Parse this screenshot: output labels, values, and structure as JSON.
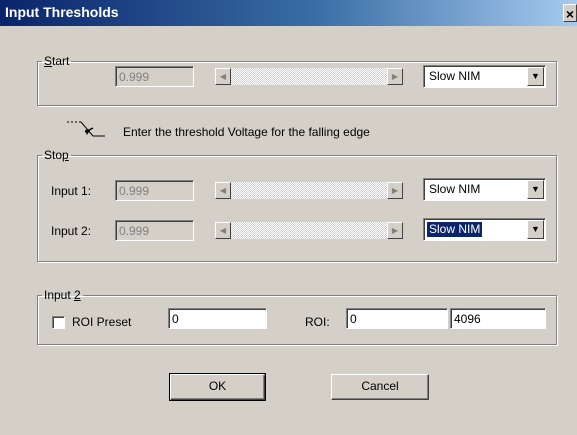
{
  "window": {
    "title": "Input Thresholds",
    "close_glyph": "×"
  },
  "start": {
    "legend_key": "S",
    "legend_rest": "tart",
    "value": "0.999",
    "mode": "Slow NIM"
  },
  "hint": {
    "icon": "falling-edge-icon",
    "text": "Enter the threshold Voltage for the falling edge"
  },
  "stop": {
    "legend_pre": "Sto",
    "legend_key": "p",
    "input1": {
      "label": "Input 1:",
      "value": "0.999",
      "mode": "Slow NIM"
    },
    "input2": {
      "label": "Input 2:",
      "value": "0.999",
      "mode": "Slow NIM"
    }
  },
  "input2_group": {
    "legend_pre": "Input ",
    "legend_key": "2",
    "roi_preset_label": "ROI Preset",
    "roi_preset_checked": false,
    "preset_value": "0",
    "roi_label": "ROI:",
    "roi_from": "0",
    "roi_to": "4096"
  },
  "buttons": {
    "ok": "OK",
    "cancel": "Cancel"
  },
  "glyphs": {
    "left": "◀",
    "right": "▶",
    "down": "▼"
  },
  "colors": {
    "titlebar": "#0a246a",
    "face": "#d4d0c8",
    "selection": "#0a246a"
  }
}
